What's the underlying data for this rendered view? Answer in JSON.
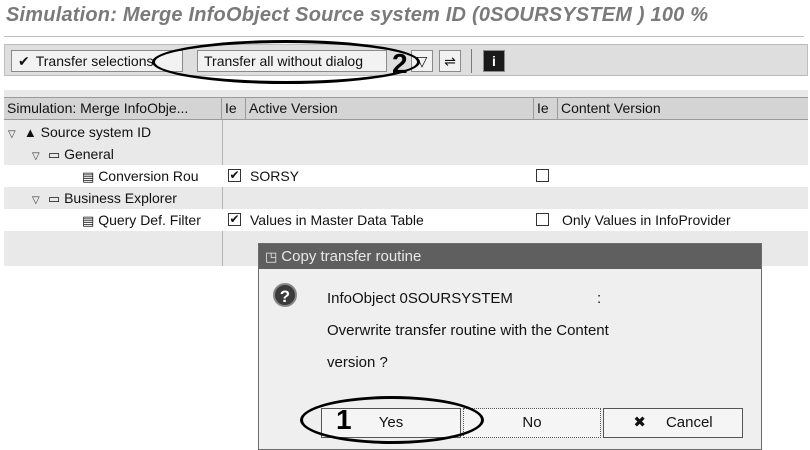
{
  "title": "Simulation: Merge InfoObject Source system ID (0SOURSYSTEM ) 100 %",
  "toolbar": {
    "transfer_selections": "Transfer selections",
    "transfer_all": "Transfer all without dialog"
  },
  "grid": {
    "headers": [
      "Simulation: Merge InfoObje...",
      "Ie",
      "Active Version",
      "Ie",
      "Content Version"
    ],
    "rows": [
      {
        "name": "Source system ID",
        "icon": "hierarchy-icon",
        "active": "",
        "content": ""
      },
      {
        "name": "General",
        "icon": "folder-icon",
        "active": "",
        "content": ""
      },
      {
        "name": "Conversion Rou",
        "icon": "document-icon",
        "active_checked": true,
        "active": "SORSY",
        "content_checked": false,
        "content": ""
      },
      {
        "name": "Business Explorer",
        "icon": "folder-open-icon",
        "active": "",
        "content": ""
      },
      {
        "name": "Query Def. Filter",
        "icon": "document-icon",
        "active_checked": true,
        "active": "Values in Master Data Table",
        "content_checked": false,
        "content": "Only Values in InfoProvider"
      }
    ]
  },
  "dialog": {
    "title": "Copy transfer routine",
    "line1_left": "InfoObject 0SOURSYSTEM",
    "line1_right": ":",
    "line2": "Overwrite transfer routine with the Content",
    "line3": "version ?",
    "yes": "Yes",
    "no": "No",
    "cancel": "Cancel"
  },
  "callouts": {
    "one": "1",
    "two": "2"
  }
}
